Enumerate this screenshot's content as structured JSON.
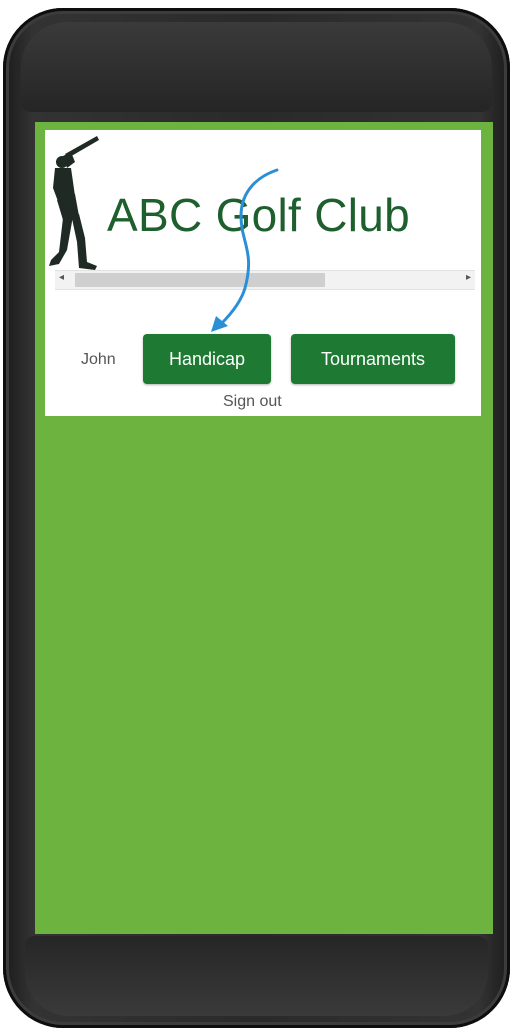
{
  "header": {
    "title": "ABC Golf Club"
  },
  "user": {
    "name": "John"
  },
  "nav": {
    "handicap_label": "Handicap",
    "tournaments_label": "Tournaments",
    "signout_label": "Sign out"
  },
  "colors": {
    "screen_background": "#6db33f",
    "button_green": "#1e7a32",
    "title_green": "#1e5f2e",
    "annotation_arrow": "#2a8fd6"
  },
  "icons": {
    "logo": "golfer-silhouette-icon",
    "annotation": "arrow-annotation-icon"
  }
}
